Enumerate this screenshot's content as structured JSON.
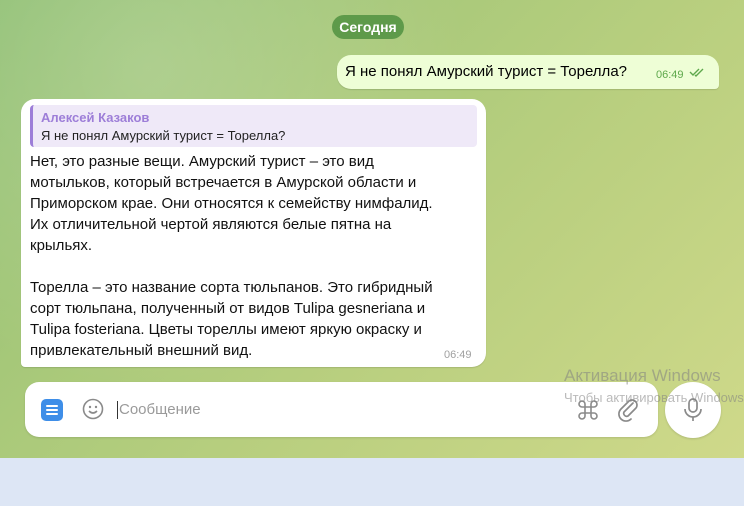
{
  "chat": {
    "date_label": "Сегодня",
    "outgoing": {
      "text": "Я не понял Амурский турист = Торелла?",
      "time": "06:49",
      "status_icon": "double-check-icon"
    },
    "incoming": {
      "reply": {
        "author": "Алексей Казаков",
        "text": "Я не понял Амурский турист = Торелла?"
      },
      "lines": [
        "Нет, это разные вещи. Амурский турист – это вид",
        "мотыльков, который встречается в Амурской области и",
        "Приморском крае. Они относятся к семейству нимфалид.",
        "Их отличительной чертой являются белые пятна на",
        "крыльях.",
        "Торелла – это название сорта тюльпанов. Это гибридный",
        "сорт тюльпана, полученный от видов Tulipa gesneriana и",
        "Tulipa fosteriana. Цветы тореллы имеют яркую окраску и",
        "привлекательный внешний вид."
      ],
      "time": "06:49"
    }
  },
  "composer": {
    "placeholder": "Сообщение",
    "icons": [
      "menu-icon",
      "emoji-icon",
      "command-icon",
      "paperclip-icon",
      "microphone-icon"
    ]
  },
  "watermark": {
    "title": "Активация Windows",
    "subtitle": "Чтобы активировать Windows"
  },
  "colors": {
    "date_pill": "#5e9a4a",
    "outgoing_bubble": "#eefed6",
    "reply_accent": "#9d7ed8",
    "menu_button": "#3e8ee8",
    "time_outgoing": "#5da84b"
  }
}
